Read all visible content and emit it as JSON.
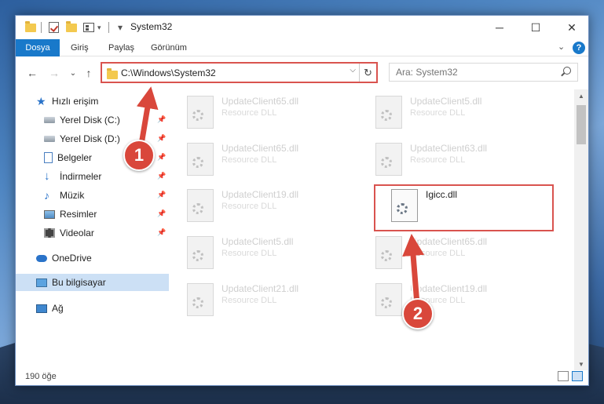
{
  "window": {
    "title": "System32",
    "minimize_glyph": "─",
    "maximize_glyph": "☐",
    "close_glyph": "✕"
  },
  "ribbon": {
    "tabs": [
      {
        "label": "Dosya",
        "active": true
      },
      {
        "label": "Giriş",
        "active": false
      },
      {
        "label": "Paylaş",
        "active": false
      },
      {
        "label": "Görünüm",
        "active": false
      }
    ],
    "expand_glyph": "⌄",
    "help_glyph": "?"
  },
  "nav": {
    "back_glyph": "←",
    "forward_glyph": "→",
    "recent_glyph": "⌄",
    "up_glyph": "↑",
    "address": "C:\\Windows\\System32",
    "address_dropdown_glyph": "⌵",
    "refresh_glyph": "↻",
    "search_placeholder": "Ara: System32"
  },
  "sidebar": {
    "items": [
      {
        "label": "Hızlı erişim",
        "icon": "star-icon",
        "pinned": false
      },
      {
        "label": "Yerel Disk (C:)",
        "icon": "drive-icon",
        "pinned": true
      },
      {
        "label": "Yerel Disk (D:)",
        "icon": "drive-icon",
        "pinned": true
      },
      {
        "label": "Belgeler",
        "icon": "documents-icon",
        "pinned": true
      },
      {
        "label": "İndirmeler",
        "icon": "download-icon",
        "pinned": true
      },
      {
        "label": "Müzik",
        "icon": "music-icon",
        "pinned": true
      },
      {
        "label": "Resimler",
        "icon": "pictures-icon",
        "pinned": true
      },
      {
        "label": "Videolar",
        "icon": "videos-icon",
        "pinned": true
      },
      {
        "label": "OneDrive",
        "icon": "cloud-icon",
        "pinned": false
      },
      {
        "label": "Bu bilgisayar",
        "icon": "computer-icon",
        "pinned": false
      },
      {
        "label": "Ağ",
        "icon": "network-icon",
        "pinned": false
      }
    ],
    "pin_glyph": "📌"
  },
  "files": [
    {
      "name": "UpdateClient65.dll",
      "type": "Resource DLL"
    },
    {
      "name": "UpdateClient5.dll",
      "type": "Resource DLL"
    },
    {
      "name": "UpdateClient65.dll",
      "type": "Resource DLL"
    },
    {
      "name": "UpdateClient63.dll",
      "type": "Resource DLL"
    },
    {
      "name": "UpdateClient19.dll",
      "type": "Resource DLL"
    },
    {
      "name": "Igicc.dll",
      "type": ""
    },
    {
      "name": "UpdateClient5.dll",
      "type": "Resource DLL"
    },
    {
      "name": "UpdateClient65.dll",
      "type": "Resource DLL"
    },
    {
      "name": "UpdateClient21.dll",
      "type": "Resource DLL"
    },
    {
      "name": "UpdateClient19.dll",
      "type": "Resource DLL"
    }
  ],
  "status": {
    "count": "190 öğe"
  },
  "scroll": {
    "up_glyph": "▲",
    "down_glyph": "▼"
  },
  "annotations": {
    "step1": "1",
    "step2": "2",
    "color": "#d9473b"
  }
}
